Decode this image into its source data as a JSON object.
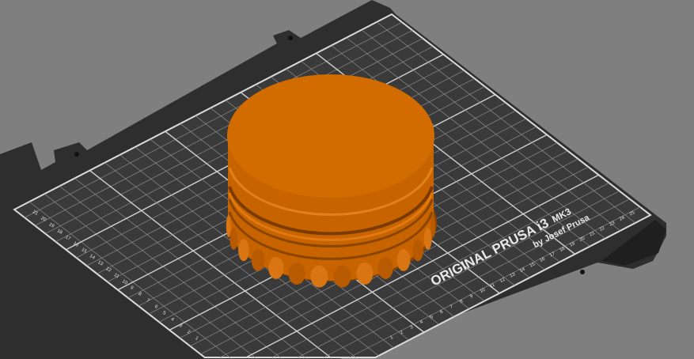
{
  "scene": {
    "background": "#7f7f7f",
    "bed_color": "#2e2e2e",
    "sheet_color": "#3a3a3a",
    "grid_color": "#9a9a9a",
    "model_color": "#d46a00"
  },
  "bed": {
    "brand": "ORIGINAL PRUSA i3",
    "model": "MK3",
    "byline": "by Josef Prusa",
    "x_ticks": [
      "1",
      "2",
      "3",
      "4",
      "5",
      "6",
      "7",
      "8",
      "9",
      "10",
      "11",
      "12",
      "13",
      "14",
      "15",
      "16",
      "17",
      "18",
      "19",
      "20",
      "21",
      "22",
      "23",
      "24",
      "25"
    ],
    "y_ticks": [
      "1",
      "2",
      "3",
      "4",
      "5",
      "6",
      "7",
      "8",
      "9",
      "10",
      "11",
      "12",
      "13",
      "14",
      "15",
      "16",
      "17",
      "18",
      "19",
      "20",
      "21"
    ]
  }
}
